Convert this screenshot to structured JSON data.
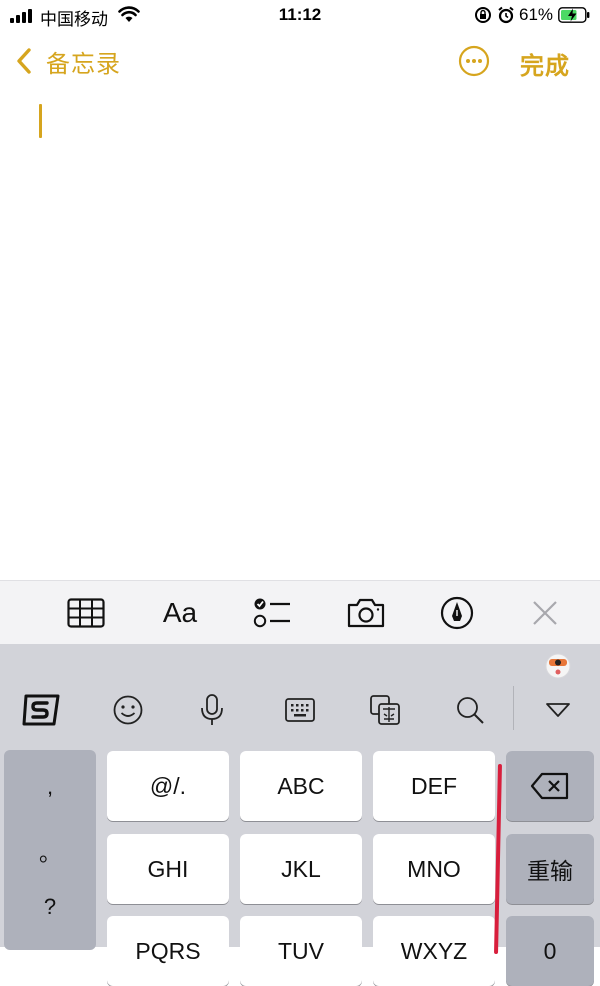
{
  "status_bar": {
    "carrier": "中国移动",
    "time": "11:12",
    "battery_percent": "61%"
  },
  "nav": {
    "back_label": "备忘录",
    "done_label": "完成"
  },
  "notes_toolbar": {
    "format_label": "Aa"
  },
  "keyboard": {
    "punctuation": [
      ",",
      "。",
      "?"
    ],
    "rows": [
      [
        "@/.",
        "ABC",
        "DEF"
      ],
      [
        "GHI",
        "JKL",
        "MNO"
      ],
      [
        "PQRS",
        "TUV",
        "WXYZ"
      ]
    ],
    "reenter_label": "重输",
    "zero_label": "0"
  },
  "colors": {
    "accent": "#d6a51e",
    "keyboard_bg": "#d2d3d9",
    "toolbar_bg": "#f3f3f5"
  }
}
